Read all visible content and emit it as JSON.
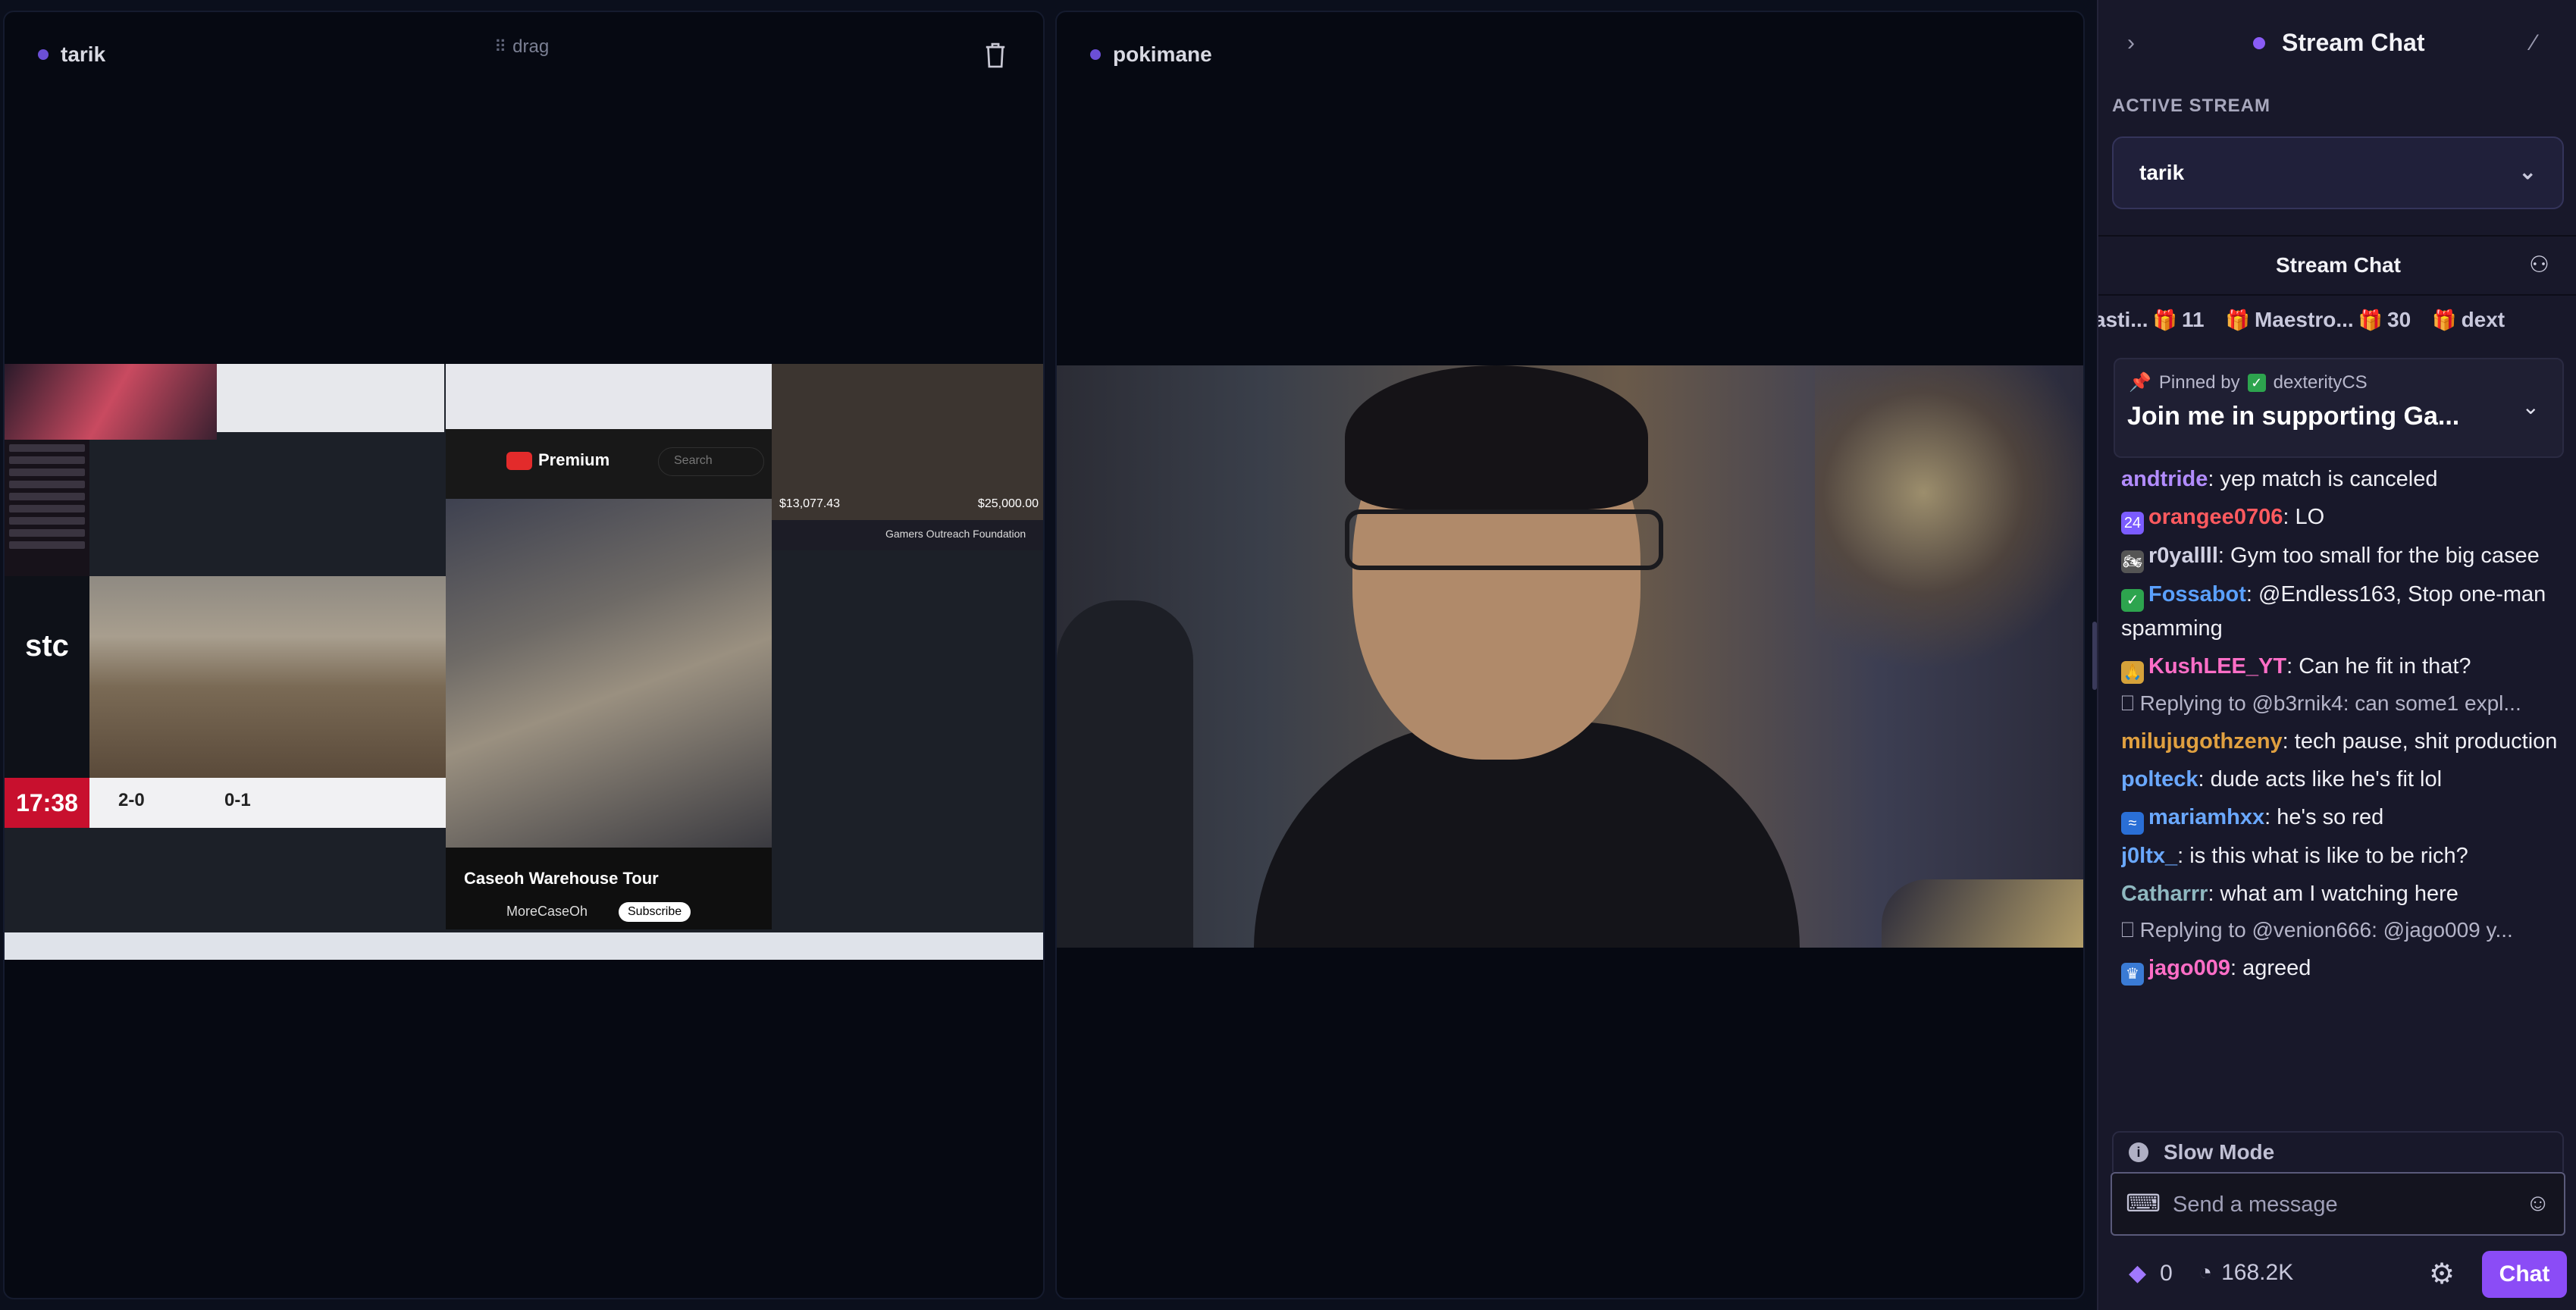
{
  "streams": [
    {
      "name": "tarik",
      "drag_label": "drag"
    },
    {
      "name": "pokimane"
    }
  ],
  "left_video": {
    "timer": "17:38",
    "youtube_brand": "Premium",
    "youtube_search": "Search",
    "youtube_title": "Caseoh Warehouse Tour",
    "channel": "MoreCaseOh",
    "subscribe": "Subscribe",
    "donation_left": "$13,077.43",
    "donation_right": "$25,000.00",
    "donation_label": "Gamers Outreach Foundation",
    "score_left": "2-0",
    "score_right": "0-1",
    "sponsor": "stc"
  },
  "sidebar": {
    "title": "Stream Chat",
    "active_stream_label": "ACTIVE STREAM",
    "active_stream_value": "tarik",
    "chat_title": "Stream Chat",
    "gifts": [
      {
        "name": "asti...",
        "count": "11"
      },
      {
        "name": "Maestro...",
        "count": "30"
      },
      {
        "name": "dext",
        "count": ""
      }
    ],
    "pinned": {
      "by_label": "Pinned by",
      "by_user": "dexterityCS",
      "message": "Join me in supporting Ga..."
    },
    "messages": [
      {
        "type": "msg",
        "user": "andtride",
        "color": "#b28cff",
        "text": ": yep match is canceled",
        "badge": ""
      },
      {
        "type": "msg",
        "user": "orangee0706",
        "color": "#ff5a5f",
        "text": ": LO",
        "badge": "24"
      },
      {
        "type": "msg",
        "user": "r0yallll",
        "color": "#d0d0e2",
        "text": ": Gym too small for the big casee",
        "badge": "🏍"
      },
      {
        "type": "msg",
        "user": "Fossabot",
        "color": "#5aa0ff",
        "text": ": @Endless163, Stop one-man spamming",
        "badge": "✓"
      },
      {
        "type": "msg",
        "user": "KushLEE_YT",
        "color": "#ff6ec7",
        "text": ": Can he fit in that?",
        "badge": "🙏"
      },
      {
        "type": "reply",
        "text": "Replying to @b3rnik4: can some1 expl..."
      },
      {
        "type": "msg",
        "user": "milujugothzeny",
        "color": "#e0a040",
        "text": ": tech pause, shit production",
        "badge": ""
      },
      {
        "type": "msg",
        "user": "polteck",
        "color": "#6aa8ff",
        "text": ": dude acts like he's fit lol",
        "badge": ""
      },
      {
        "type": "msg",
        "user": "mariamhxx",
        "color": "#6aa8ff",
        "text": ": he's so red",
        "badge": "≈"
      },
      {
        "type": "msg",
        "user": "j0ltx_",
        "color": "#6aa8ff",
        "text": ": is this what is like to be rich?",
        "badge": ""
      },
      {
        "type": "msg",
        "user": "Catharrr",
        "color": "#8fb8c0",
        "text": ": what am I watching here",
        "badge": ""
      },
      {
        "type": "reply",
        "text": "Replying to @venion666: @jago009 y..."
      },
      {
        "type": "msg",
        "user": "jago009",
        "color": "#ff6ec7",
        "text": ": agreed",
        "badge": "♛"
      }
    ],
    "slow_mode": "Slow Mode",
    "message_placeholder": "Send a message",
    "bits": "0",
    "points": "168.2K",
    "chat_button": "Chat"
  },
  "colors": {
    "accent": "#8b4cf6",
    "background": "#0b0f1c",
    "sidebar": "#18182a"
  }
}
